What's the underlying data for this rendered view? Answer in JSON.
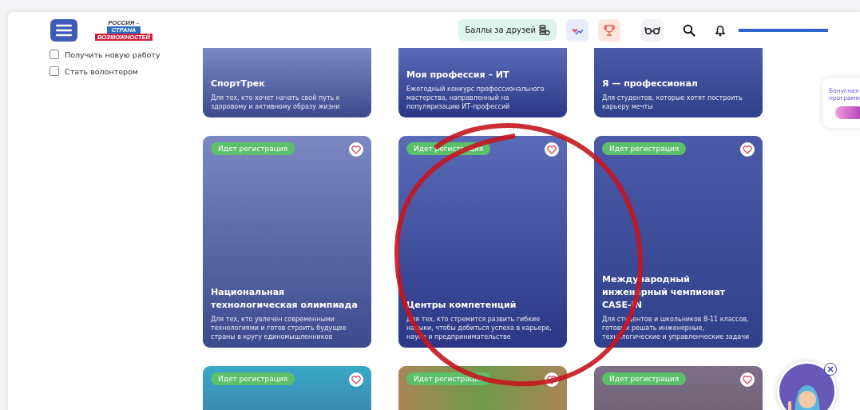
{
  "header": {
    "logo": [
      "РОССИЯ –",
      "СТРАНА",
      "ВОЗМОЖНОСТЕЙ"
    ],
    "points_button": "Баллы за друзей"
  },
  "sidebar": {
    "checkboxes": [
      {
        "label": "Получить новую работу",
        "checked": false
      },
      {
        "label": "Стать волонтером",
        "checked": false
      }
    ]
  },
  "cards": [
    {
      "title": "СпортТрек",
      "description": "Для тех, кто хочет начать свой путь к здоровому и активному образу жизни"
    },
    {
      "title": "Моя профессия – ИТ",
      "description": "Ежегодный конкурс профессионального мастерства, направленный на популяризацию ИТ-профессий"
    },
    {
      "title": "Я — профессионал",
      "description": "Для студентов, которые хотят построить карьеру мечты"
    },
    {
      "badge": "Идет регистрация",
      "title": "Национальная технологическая олимпиада",
      "description": "Для тех, кто увлечен современными технологиями и готов строить будущее страны в кругу единомышленников"
    },
    {
      "badge": "Идет регистрация",
      "title": "Центры компетенций",
      "description": "Для тех, кто стремится развить гибкие навыки, чтобы добиться успеха в карьере, науке и предпринимательстве"
    },
    {
      "badge": "Идет регистрация",
      "title": "Международный инженерный чемпионат CASE-IN",
      "description": "Для студентов и школьников 8-11 классов, готовых решать инженерные, технологические и управленческие задачи"
    },
    {
      "badge": "Идет регистрация"
    },
    {
      "badge": "Идет регистрация"
    },
    {
      "badge": "Идет регистрация"
    }
  ],
  "bonus_panel": [
    "Бонусная",
    "программ"
  ]
}
